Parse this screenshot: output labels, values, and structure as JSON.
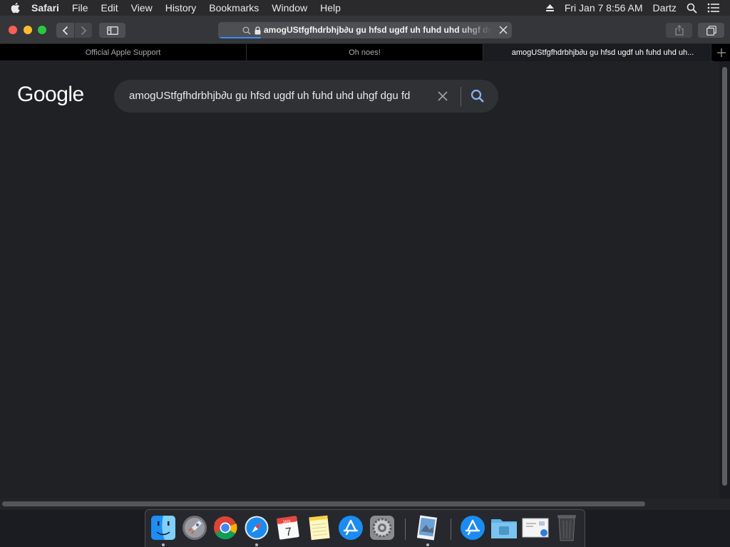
{
  "menubar": {
    "apple": "apple-logo-icon",
    "items": [
      "Safari",
      "File",
      "Edit",
      "View",
      "History",
      "Bookmarks",
      "Window",
      "Help"
    ],
    "datetime": "Fri Jan 7  8:56 AM",
    "user": "Dartz"
  },
  "toolbar": {
    "url": "amogUStfgfhdrbhjb∂u gu hfsd ugdf uh fuhd uhd uhgf dgu fd"
  },
  "tabs": [
    {
      "title": "Official Apple Support"
    },
    {
      "title": "Oh noes!"
    },
    {
      "title": "amogUStfgfhdrbhjb∂u gu hfsd ugdf uh fuhd uhd uh..."
    }
  ],
  "page": {
    "logo": "Google",
    "query": "amogUStfgfhdrbhjb∂u gu hfsd ugdf uh fuhd uhd uhgf dgu fd"
  },
  "dock": {
    "apps": [
      "Finder",
      "Launchpad",
      "Google Chrome",
      "Safari",
      "Calendar",
      "Notes",
      "App Store",
      "System Preferences",
      "Preview",
      "Applications",
      "Downloads",
      "Mail Draft",
      "Trash"
    ],
    "calendar_month": "JAN",
    "calendar_day": "7"
  },
  "colors": {
    "accent": "#3a8cf7",
    "page_bg": "#202124",
    "search_bg": "#303134",
    "google_blue": "#8ab4f8"
  }
}
